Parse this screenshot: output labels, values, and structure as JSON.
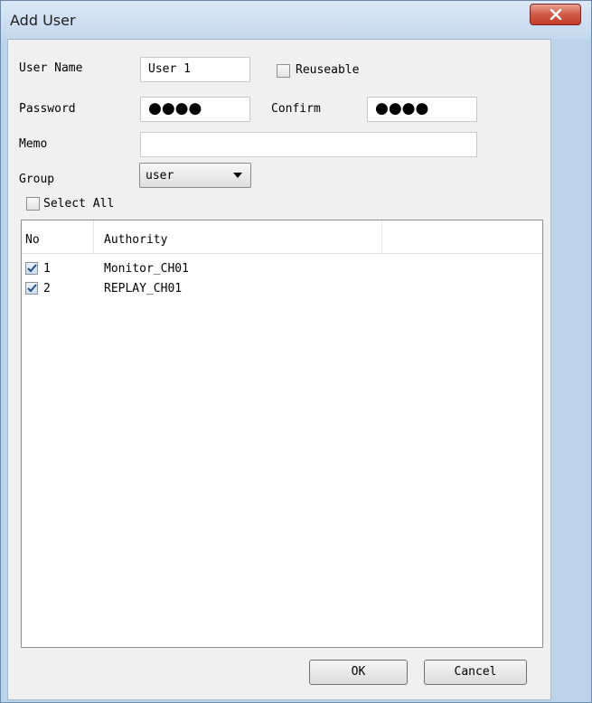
{
  "window": {
    "title": "Add User"
  },
  "form": {
    "user_name_label": "User Name",
    "user_name_value": "User 1",
    "reuseable_label": "Reuseable",
    "password_label": "Password",
    "password_value": "●●●●",
    "confirm_label": "Confirm",
    "confirm_value": "●●●●",
    "memo_label": "Memo",
    "memo_value": "",
    "group_label": "Group",
    "group_value": "user",
    "select_all_label": "Select All"
  },
  "authority_list": {
    "columns": [
      "No",
      "Authority"
    ],
    "rows": [
      {
        "no": "1",
        "authority": "Monitor_CH01",
        "checked": true
      },
      {
        "no": "2",
        "authority": "REPLAY_CH01",
        "checked": true
      }
    ]
  },
  "buttons": {
    "ok": "OK",
    "cancel": "Cancel"
  },
  "colors": {
    "close_button": "#c43b26",
    "frame": "#bcd4ea",
    "client": "#f0f0f0"
  }
}
